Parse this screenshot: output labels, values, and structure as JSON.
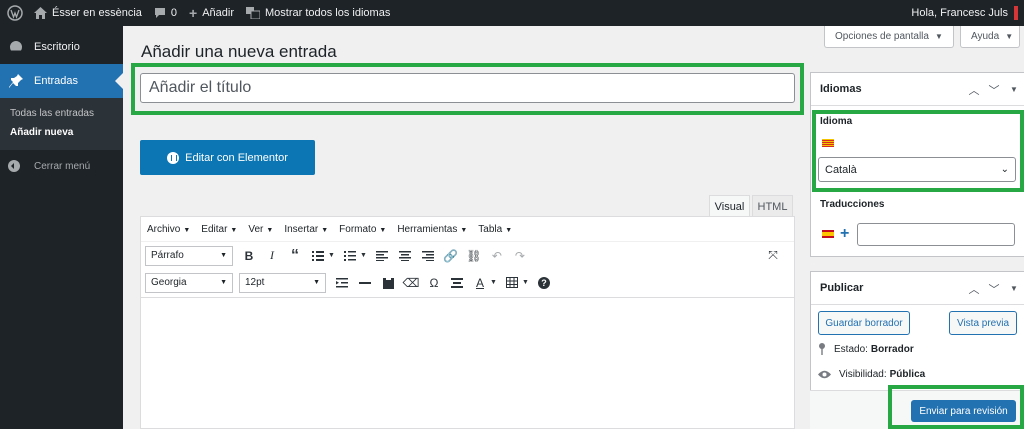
{
  "admin_bar": {
    "site_name": "Ésser en essència",
    "comments_count": "0",
    "new_label": "Añadir",
    "show_languages": "Mostrar todos los idiomas",
    "greeting": "Hola, Francesc Juls"
  },
  "sidebar": {
    "dashboard": "Escritorio",
    "posts": "Entradas",
    "submenu": [
      "Todas las entradas",
      "Añadir nueva"
    ],
    "collapse": "Cerrar menú"
  },
  "screen_options": {
    "options_label": "Opciones de pantalla",
    "help_label": "Ayuda"
  },
  "page_title": "Añadir una nueva entrada",
  "title_input": {
    "placeholder": "Añadir el título",
    "value": ""
  },
  "elementor_button": "Editar con Elementor",
  "editor": {
    "tabs": [
      "Visual",
      "HTML"
    ],
    "active_tab": "Visual",
    "menus": [
      "Archivo",
      "Editar",
      "Ver",
      "Insertar",
      "Formato",
      "Herramientas",
      "Tabla"
    ],
    "format_select": "Párrafo",
    "font_select": "Georgia",
    "size_select": "12pt"
  },
  "languages_panel": {
    "title": "Idiomas",
    "language_label": "Idioma",
    "language_value": "Català",
    "translations_label": "Traducciones"
  },
  "publish_panel": {
    "title": "Publicar",
    "save_draft": "Guardar borrador",
    "preview": "Vista previa",
    "status_label": "Estado:",
    "status_value": "Borrador",
    "visibility_label": "Visibilidad:",
    "visibility_value": "Pública",
    "submit": "Enviar para revisión"
  },
  "colors": {
    "accent": "#2271b1",
    "highlight": "#28a745",
    "admin_bar": "#1d2327",
    "elementor": "#0b76b3"
  }
}
